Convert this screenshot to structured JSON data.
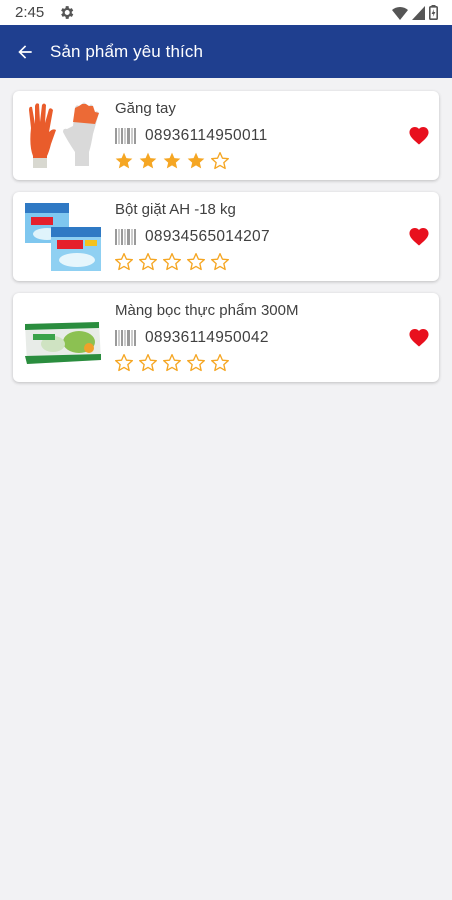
{
  "status_bar": {
    "time": "2:45"
  },
  "app_bar": {
    "title": "Sản phẩm yêu thích"
  },
  "colors": {
    "primary": "#1f3f8f",
    "star": "#f5a623",
    "heart": "#e8101e"
  },
  "products": [
    {
      "name": "Găng tay",
      "barcode": "08936114950011",
      "rating": 4,
      "thumbnail": "gloves-image",
      "favorite": true
    },
    {
      "name": "Bột giặt AH -18 kg",
      "barcode": "08934565014207",
      "rating": 0,
      "thumbnail": "detergent-image",
      "favorite": true
    },
    {
      "name": "Màng bọc thực phẩm 300M",
      "barcode": "08936114950042",
      "rating": 0,
      "thumbnail": "food-wrap-image",
      "favorite": true
    }
  ]
}
